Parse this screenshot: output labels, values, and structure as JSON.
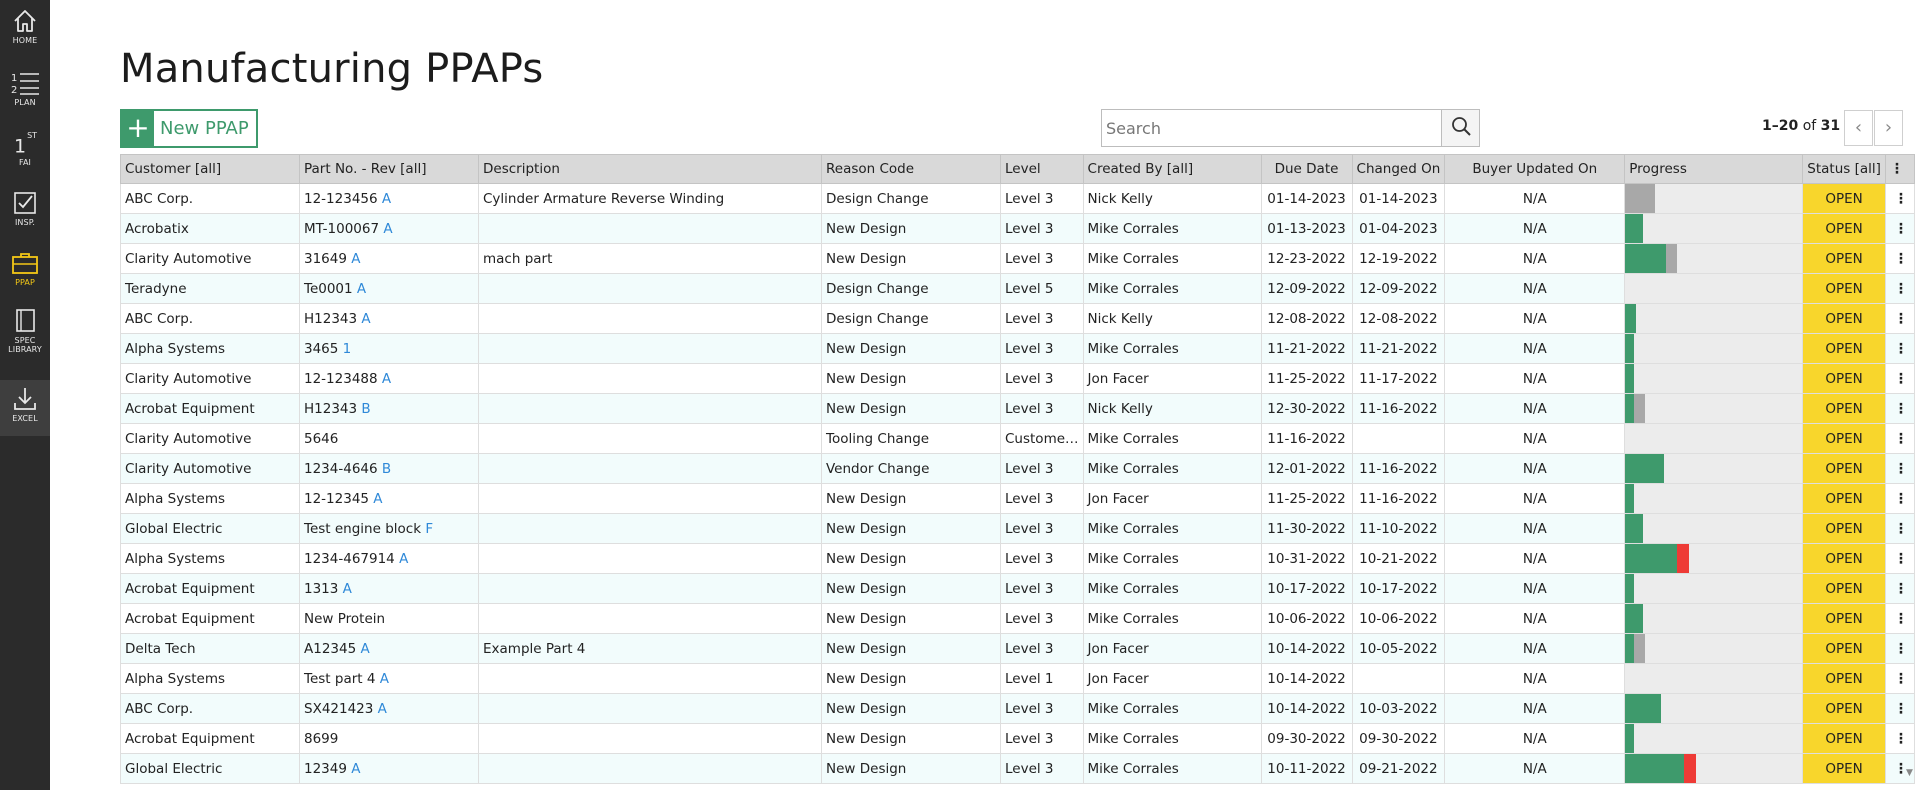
{
  "sidebar": {
    "items": [
      {
        "label": "HOME",
        "icon": "home-icon"
      },
      {
        "label": "PLAN",
        "icon": "numbered-list-icon"
      },
      {
        "label": "FAI",
        "glyph": "1",
        "sup": "ST",
        "icon": "first-article-icon"
      },
      {
        "label": "INSP.",
        "icon": "checkbox-icon"
      },
      {
        "label": "PPAP",
        "icon": "briefcase-icon",
        "active": true
      },
      {
        "label": "SPEC",
        "label2": "LIBRARY",
        "icon": "book-icon"
      },
      {
        "label": "EXCEL",
        "icon": "download-icon"
      }
    ],
    "colors": {
      "background": "#2b2b2b",
      "active": "#f4c816"
    }
  },
  "page": {
    "title": "Manufacturing PPAPs"
  },
  "toolbar": {
    "new_button_label": "New PPAP",
    "new_button_plus": "+",
    "search_placeholder": "Search",
    "search_value": "",
    "pager_range": "1–20",
    "pager_of": "of",
    "pager_total": "31",
    "prev_glyph": "‹",
    "next_glyph": "›"
  },
  "table": {
    "columns": [
      {
        "key": "customer",
        "label": "Customer [all]"
      },
      {
        "key": "part",
        "label": "Part No. - Rev [all]"
      },
      {
        "key": "description",
        "label": "Description"
      },
      {
        "key": "reason",
        "label": "Reason Code"
      },
      {
        "key": "level",
        "label": "Level"
      },
      {
        "key": "created_by",
        "label": "Created By [all]"
      },
      {
        "key": "due",
        "label": "Due Date"
      },
      {
        "key": "changed",
        "label": "Changed On"
      },
      {
        "key": "buyer",
        "label": "Buyer Updated On"
      },
      {
        "key": "progress",
        "label": "Progress"
      },
      {
        "key": "status",
        "label": "Status [all]"
      },
      {
        "key": "menu",
        "label": "⋮"
      }
    ],
    "rows": [
      {
        "customer": "ABC Corp.",
        "part": "12-123456",
        "rev": "A",
        "description": "Cylinder Armature Reverse Winding",
        "reason": "Design Change",
        "level": "Level 3",
        "created_by": "Nick Kelly",
        "due": "01-14-2023",
        "changed": "01-14-2023",
        "buyer": "N/A",
        "progress": {
          "green": 0,
          "gray": 0.17,
          "red": 0
        },
        "status": "OPEN"
      },
      {
        "customer": "Acrobatix",
        "part": "MT-100067",
        "rev": "A",
        "description": "",
        "reason": "New Design",
        "level": "Level 3",
        "created_by": "Mike Corrales",
        "due": "01-13-2023",
        "changed": "01-04-2023",
        "buyer": "N/A",
        "progress": {
          "green": 0.1,
          "gray": 0,
          "red": 0
        },
        "status": "OPEN"
      },
      {
        "customer": "Clarity Automotive",
        "part": "31649",
        "rev": "A",
        "description": "mach part",
        "reason": "New Design",
        "level": "Level 3",
        "created_by": "Mike Corrales",
        "due": "12-23-2022",
        "changed": "12-19-2022",
        "buyer": "N/A",
        "progress": {
          "green": 0.23,
          "gray": 0.06,
          "red": 0
        },
        "status": "OPEN"
      },
      {
        "customer": "Teradyne",
        "part": "Te0001",
        "rev": "A",
        "description": "",
        "reason": "Design Change",
        "level": "Level 5",
        "created_by": "Mike Corrales",
        "due": "12-09-2022",
        "changed": "12-09-2022",
        "buyer": "N/A",
        "progress": {
          "green": 0,
          "gray": 0,
          "red": 0
        },
        "status": "OPEN"
      },
      {
        "customer": "ABC Corp.",
        "part": "H12343",
        "rev": "A",
        "description": "",
        "reason": "Design Change",
        "level": "Level 3",
        "created_by": "Nick Kelly",
        "due": "12-08-2022",
        "changed": "12-08-2022",
        "buyer": "N/A",
        "progress": {
          "green": 0.06,
          "gray": 0,
          "red": 0
        },
        "status": "OPEN"
      },
      {
        "customer": "Alpha Systems",
        "part": "3465",
        "rev": "1",
        "description": "",
        "reason": "New Design",
        "level": "Level 3",
        "created_by": "Mike Corrales",
        "due": "11-21-2022",
        "changed": "11-21-2022",
        "buyer": "N/A",
        "progress": {
          "green": 0.05,
          "gray": 0,
          "red": 0
        },
        "status": "OPEN"
      },
      {
        "customer": "Clarity Automotive",
        "part": "12-123488",
        "rev": "A",
        "description": "",
        "reason": "New Design",
        "level": "Level 3",
        "created_by": "Jon Facer",
        "due": "11-25-2022",
        "changed": "11-17-2022",
        "buyer": "N/A",
        "progress": {
          "green": 0.05,
          "gray": 0,
          "red": 0
        },
        "status": "OPEN"
      },
      {
        "customer": "Acrobat Equipment",
        "part": "H12343",
        "rev": "B",
        "description": "",
        "reason": "New Design",
        "level": "Level 3",
        "created_by": "Nick Kelly",
        "due": "12-30-2022",
        "changed": "11-16-2022",
        "buyer": "N/A",
        "progress": {
          "green": 0.05,
          "gray": 0.06,
          "red": 0
        },
        "status": "OPEN"
      },
      {
        "customer": "Clarity Automotive",
        "part": "5646",
        "rev": "",
        "description": "",
        "reason": "Tooling Change",
        "level": "Custome…",
        "created_by": "Mike Corrales",
        "due": "11-16-2022",
        "changed": "",
        "buyer": "N/A",
        "progress": {
          "green": 0,
          "gray": 0,
          "red": 0
        },
        "status": "OPEN"
      },
      {
        "customer": "Clarity Automotive",
        "part": "1234-4646",
        "rev": "B",
        "description": "",
        "reason": "Vendor Change",
        "level": "Level 3",
        "created_by": "Mike Corrales",
        "due": "12-01-2022",
        "changed": "11-16-2022",
        "buyer": "N/A",
        "progress": {
          "green": 0.22,
          "gray": 0,
          "red": 0
        },
        "status": "OPEN"
      },
      {
        "customer": "Alpha Systems",
        "part": "12-12345",
        "rev": "A",
        "description": "",
        "reason": "New Design",
        "level": "Level 3",
        "created_by": "Jon Facer",
        "due": "11-25-2022",
        "changed": "11-16-2022",
        "buyer": "N/A",
        "progress": {
          "green": 0.05,
          "gray": 0,
          "red": 0
        },
        "status": "OPEN"
      },
      {
        "customer": "Global Electric",
        "part": "Test engine block",
        "rev": "F",
        "description": "",
        "reason": "New Design",
        "level": "Level 3",
        "created_by": "Mike Corrales",
        "due": "11-30-2022",
        "changed": "11-10-2022",
        "buyer": "N/A",
        "progress": {
          "green": 0.1,
          "gray": 0,
          "red": 0
        },
        "status": "OPEN"
      },
      {
        "customer": "Alpha Systems",
        "part": "1234-467914",
        "rev": "A",
        "description": "",
        "reason": "New Design",
        "level": "Level 3",
        "created_by": "Mike Corrales",
        "due": "10-31-2022",
        "changed": "10-21-2022",
        "buyer": "N/A",
        "progress": {
          "green": 0.29,
          "gray": 0,
          "red": 0.07
        },
        "status": "OPEN"
      },
      {
        "customer": "Acrobat Equipment",
        "part": "1313",
        "rev": "A",
        "description": "",
        "reason": "New Design",
        "level": "Level 3",
        "created_by": "Mike Corrales",
        "due": "10-17-2022",
        "changed": "10-17-2022",
        "buyer": "N/A",
        "progress": {
          "green": 0.05,
          "gray": 0,
          "red": 0
        },
        "status": "OPEN"
      },
      {
        "customer": "Acrobat Equipment",
        "part": "New Protein",
        "rev": "",
        "description": "",
        "reason": "New Design",
        "level": "Level 3",
        "created_by": "Mike Corrales",
        "due": "10-06-2022",
        "changed": "10-06-2022",
        "buyer": "N/A",
        "progress": {
          "green": 0.1,
          "gray": 0,
          "red": 0
        },
        "status": "OPEN"
      },
      {
        "customer": "Delta Tech",
        "part": "A12345",
        "rev": "A",
        "description": "Example Part 4",
        "reason": "New Design",
        "level": "Level 3",
        "created_by": "Jon Facer",
        "due": "10-14-2022",
        "changed": "10-05-2022",
        "buyer": "N/A",
        "progress": {
          "green": 0.05,
          "gray": 0.06,
          "red": 0
        },
        "status": "OPEN"
      },
      {
        "customer": "Alpha Systems",
        "part": "Test part 4",
        "rev": "A",
        "description": "",
        "reason": "New Design",
        "level": "Level 1",
        "created_by": "Jon Facer",
        "due": "10-14-2022",
        "changed": "",
        "buyer": "N/A",
        "progress": {
          "green": 0,
          "gray": 0,
          "red": 0
        },
        "status": "OPEN"
      },
      {
        "customer": "ABC Corp.",
        "part": "SX421423",
        "rev": "A",
        "description": "",
        "reason": "New Design",
        "level": "Level 3",
        "created_by": "Mike Corrales",
        "due": "10-14-2022",
        "changed": "10-03-2022",
        "buyer": "N/A",
        "progress": {
          "green": 0.2,
          "gray": 0,
          "red": 0
        },
        "status": "OPEN"
      },
      {
        "customer": "Acrobat Equipment",
        "part": "8699",
        "rev": "",
        "description": "",
        "reason": "New Design",
        "level": "Level 3",
        "created_by": "Mike Corrales",
        "due": "09-30-2022",
        "changed": "09-30-2022",
        "buyer": "N/A",
        "progress": {
          "green": 0.05,
          "gray": 0,
          "red": 0
        },
        "status": "OPEN"
      },
      {
        "customer": "Global Electric",
        "part": "12349",
        "rev": "A",
        "description": "",
        "reason": "New Design",
        "level": "Level 3",
        "created_by": "Mike Corrales",
        "due": "10-11-2022",
        "changed": "09-21-2022",
        "buyer": "N/A",
        "progress": {
          "green": 0.33,
          "gray": 0,
          "red": 0.07
        },
        "status": "OPEN"
      }
    ]
  },
  "colors": {
    "accent": "#3e9a6c",
    "progress_green": "#3e9a6c",
    "progress_gray": "#a8a8a8",
    "progress_red": "#ee3b36",
    "progress_track": "#ececec",
    "status_open": "#f8d62c",
    "row_alt": "#f2fcfc",
    "header_bg": "#d9d9d9",
    "link": "#2f89d8"
  }
}
